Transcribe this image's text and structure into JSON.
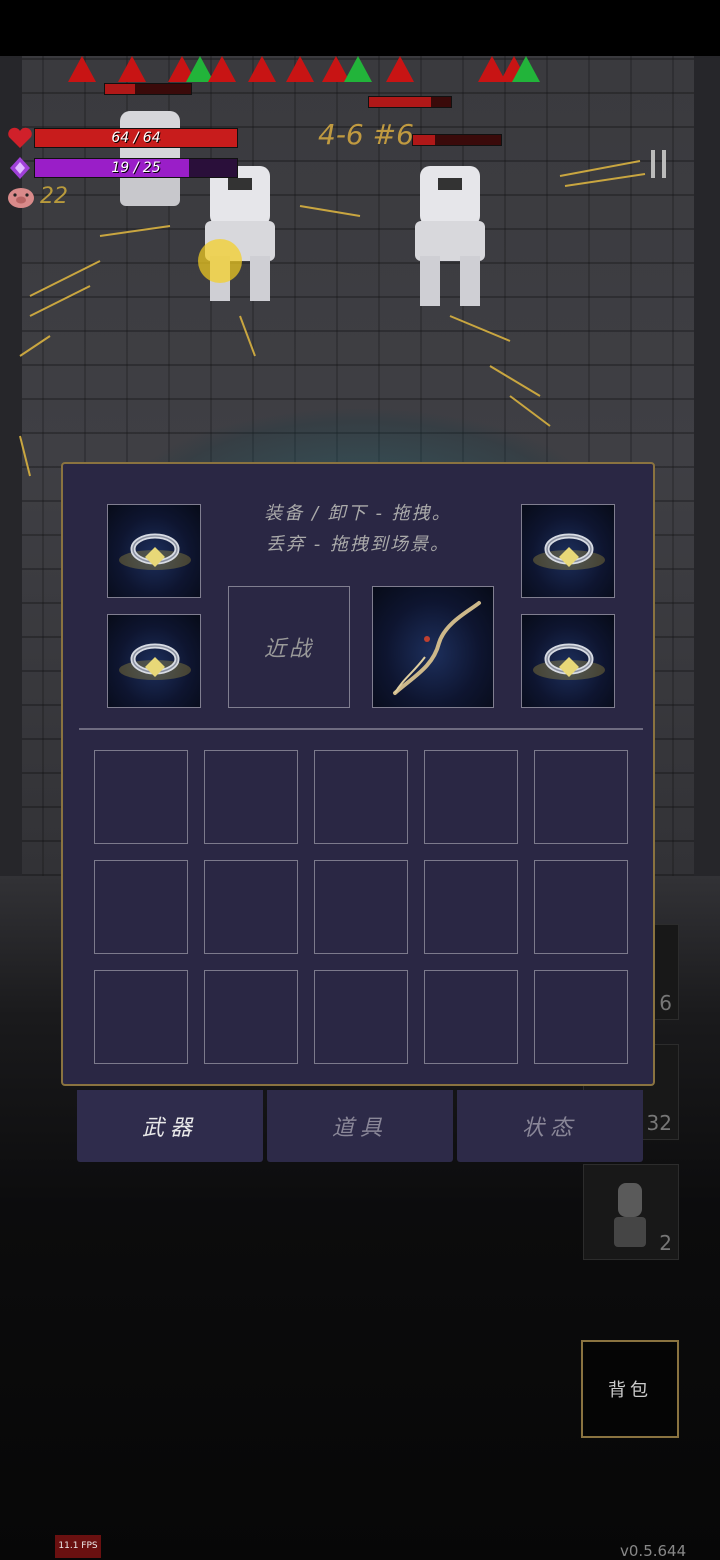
{
  "hud": {
    "hp": {
      "text": "64 / 64",
      "current": 64,
      "max": 64,
      "color": "#c81c1c"
    },
    "mp": {
      "text": "19 / 25",
      "current": 19,
      "max": 25,
      "color": "#9a1ec8"
    },
    "gold": "22",
    "level": "4-6 #6"
  },
  "equip_panel": {
    "hint_line1": "装备 / 卸下 - 拖拽。",
    "hint_line2": "丢弃 - 拖拽到场景。",
    "melee_label": "近战",
    "ring_slots": [
      "ring-icon",
      "ring-icon",
      "ring-icon",
      "ring-icon"
    ],
    "ranged_weapon": "bow-icon",
    "inventory_rows": 3,
    "inventory_cols": 5
  },
  "tabs": [
    {
      "label": "武器",
      "active": true
    },
    {
      "label": "道具",
      "active": false
    },
    {
      "label": "状态",
      "active": false
    }
  ],
  "side_slots": [
    {
      "count": "6"
    },
    {
      "count": "32"
    },
    {
      "count": "2",
      "icon": "statue-icon"
    }
  ],
  "bag_label": "背包",
  "fps": "11.1 FPS",
  "version": "v0.5.644",
  "colors": {
    "panel_bg": "#2a2744",
    "panel_border": "#8a7340",
    "gold": "#c09a40"
  }
}
